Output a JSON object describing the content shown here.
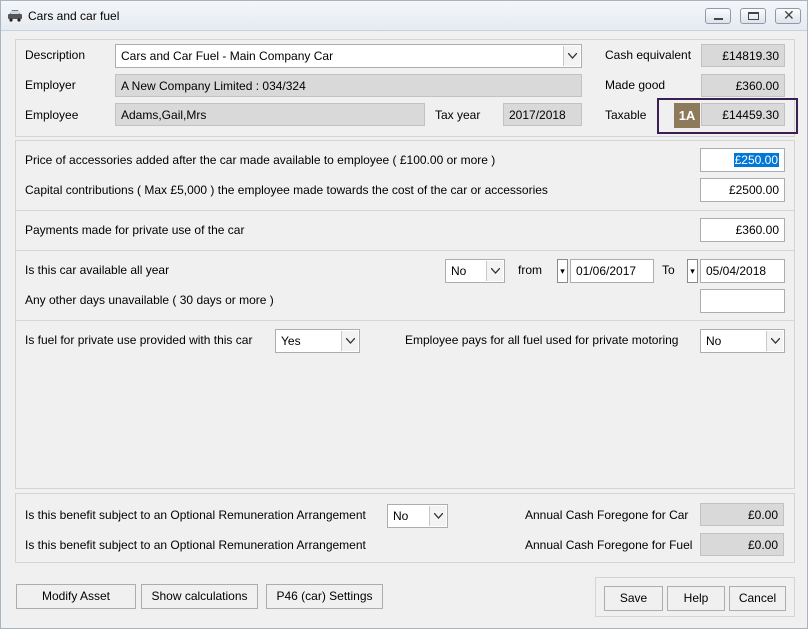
{
  "window": {
    "title": "Cars and car fuel",
    "icons": {
      "app": "car-icon",
      "minimize": "minimize-icon",
      "maximize": "maximize-icon",
      "close": "close-icon"
    }
  },
  "header": {
    "description_label": "Description",
    "description_value": "Cars and Car Fuel - Main Company Car",
    "employer_label": "Employer",
    "employer_value": "A New Company Limited : 034/324",
    "employee_label": "Employee",
    "employee_value": "Adams,Gail,Mrs",
    "tax_year_label": "Tax year",
    "tax_year_value": "2017/2018",
    "cash_equivalent_label": "Cash equivalent",
    "cash_equivalent_value": "£14819.30",
    "made_good_label": "Made good",
    "made_good_value": "£360.00",
    "taxable_label": "Taxable",
    "taxable_badge": "1A",
    "taxable_value": "£14459.30"
  },
  "accessories": {
    "price_label": "Price of accessories added after the car made available to employee ( £100.00 or  more )",
    "price_value": "£250.00",
    "capital_label": "Capital contributions ( Max £5,000 ) the employee made towards the cost of the car or accessories",
    "capital_value": "£2500.00"
  },
  "payments": {
    "label": "Payments made for private use of the car",
    "value": "£360.00"
  },
  "availability": {
    "all_year_label": "Is this car available all year",
    "all_year_value": "No",
    "from_label": "from",
    "from_value": "01/06/2017",
    "to_label": "To",
    "to_value": "05/04/2018",
    "spin_glyph": "▾",
    "other_days_label": "Any other days unavailable ( 30 days or more )",
    "other_days_value": ""
  },
  "fuel": {
    "provided_label": "Is fuel for private use provided with this car",
    "provided_value": "Yes",
    "employee_pays_label": "Employee pays for all fuel used for private motoring",
    "employee_pays_value": "No"
  },
  "ora": {
    "car_label": "Is this benefit subject to an Optional Remuneration Arrangement",
    "car_value": "No",
    "fuel_label": "Is this benefit subject to an Optional Remuneration Arrangement",
    "foregone_car_label": "Annual Cash Foregone for Car",
    "foregone_car_value": "£0.00",
    "foregone_fuel_label": "Annual Cash Foregone for Fuel",
    "foregone_fuel_value": "£0.00"
  },
  "buttons": {
    "modify_asset": "Modify Asset",
    "show_calculations": "Show calculations",
    "p46_settings": "P46 (car) Settings",
    "save": "Save",
    "help": "Help",
    "cancel": "Cancel"
  },
  "colors": {
    "badge": "#8c7a5b",
    "highlight_border": "#3b1f52",
    "selection": "#0078d7"
  }
}
